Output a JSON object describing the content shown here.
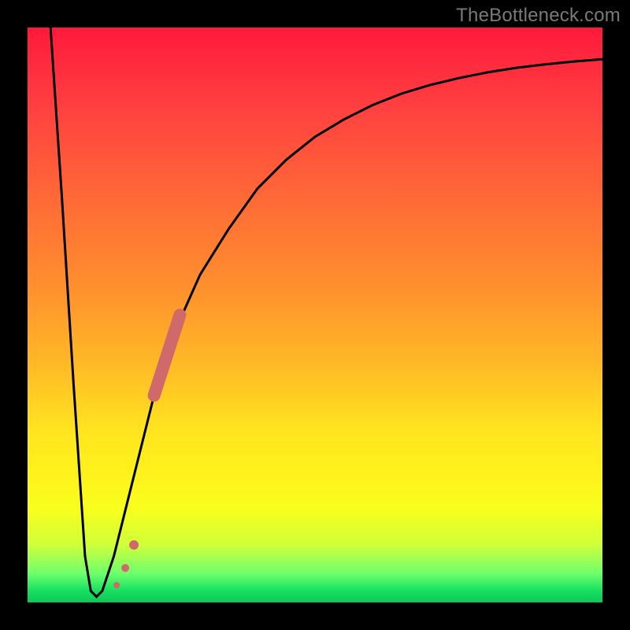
{
  "watermark": "TheBottleneck.com",
  "chart_data": {
    "type": "line",
    "title": "",
    "xlabel": "",
    "ylabel": "",
    "xlim": [
      0,
      100
    ],
    "ylim": [
      0,
      100
    ],
    "grid": false,
    "legend": false,
    "series": [
      {
        "name": "bottleneck-curve",
        "x": [
          4,
          6,
          8,
          10,
          11,
          12,
          13,
          15,
          18,
          22,
          26,
          30,
          35,
          40,
          45,
          50,
          55,
          60,
          65,
          70,
          75,
          80,
          85,
          90,
          95,
          100
        ],
        "y": [
          100,
          70,
          38,
          8,
          2,
          1,
          2,
          8,
          20,
          36,
          48,
          57,
          65,
          72,
          77,
          81,
          84,
          86.5,
          88.5,
          90,
          91.2,
          92.2,
          93,
          93.6,
          94.1,
          94.5
        ]
      }
    ],
    "markers": [
      {
        "name": "highlight-segment",
        "shape": "thick-line",
        "color": "#d06a6a",
        "x0": 22,
        "y0": 36,
        "x1": 26.5,
        "y1": 50
      },
      {
        "name": "dot-1",
        "shape": "circle",
        "color": "#d06a6a",
        "x": 18.5,
        "y": 10,
        "r": 6
      },
      {
        "name": "dot-2",
        "shape": "circle",
        "color": "#d06a6a",
        "x": 17.0,
        "y": 6,
        "r": 5
      },
      {
        "name": "dot-3",
        "shape": "circle",
        "color": "#d06a6a",
        "x": 15.5,
        "y": 3,
        "r": 4
      }
    ]
  },
  "colors": {
    "curve": "#000000",
    "marker": "#d06a6a",
    "frame": "#000000"
  }
}
